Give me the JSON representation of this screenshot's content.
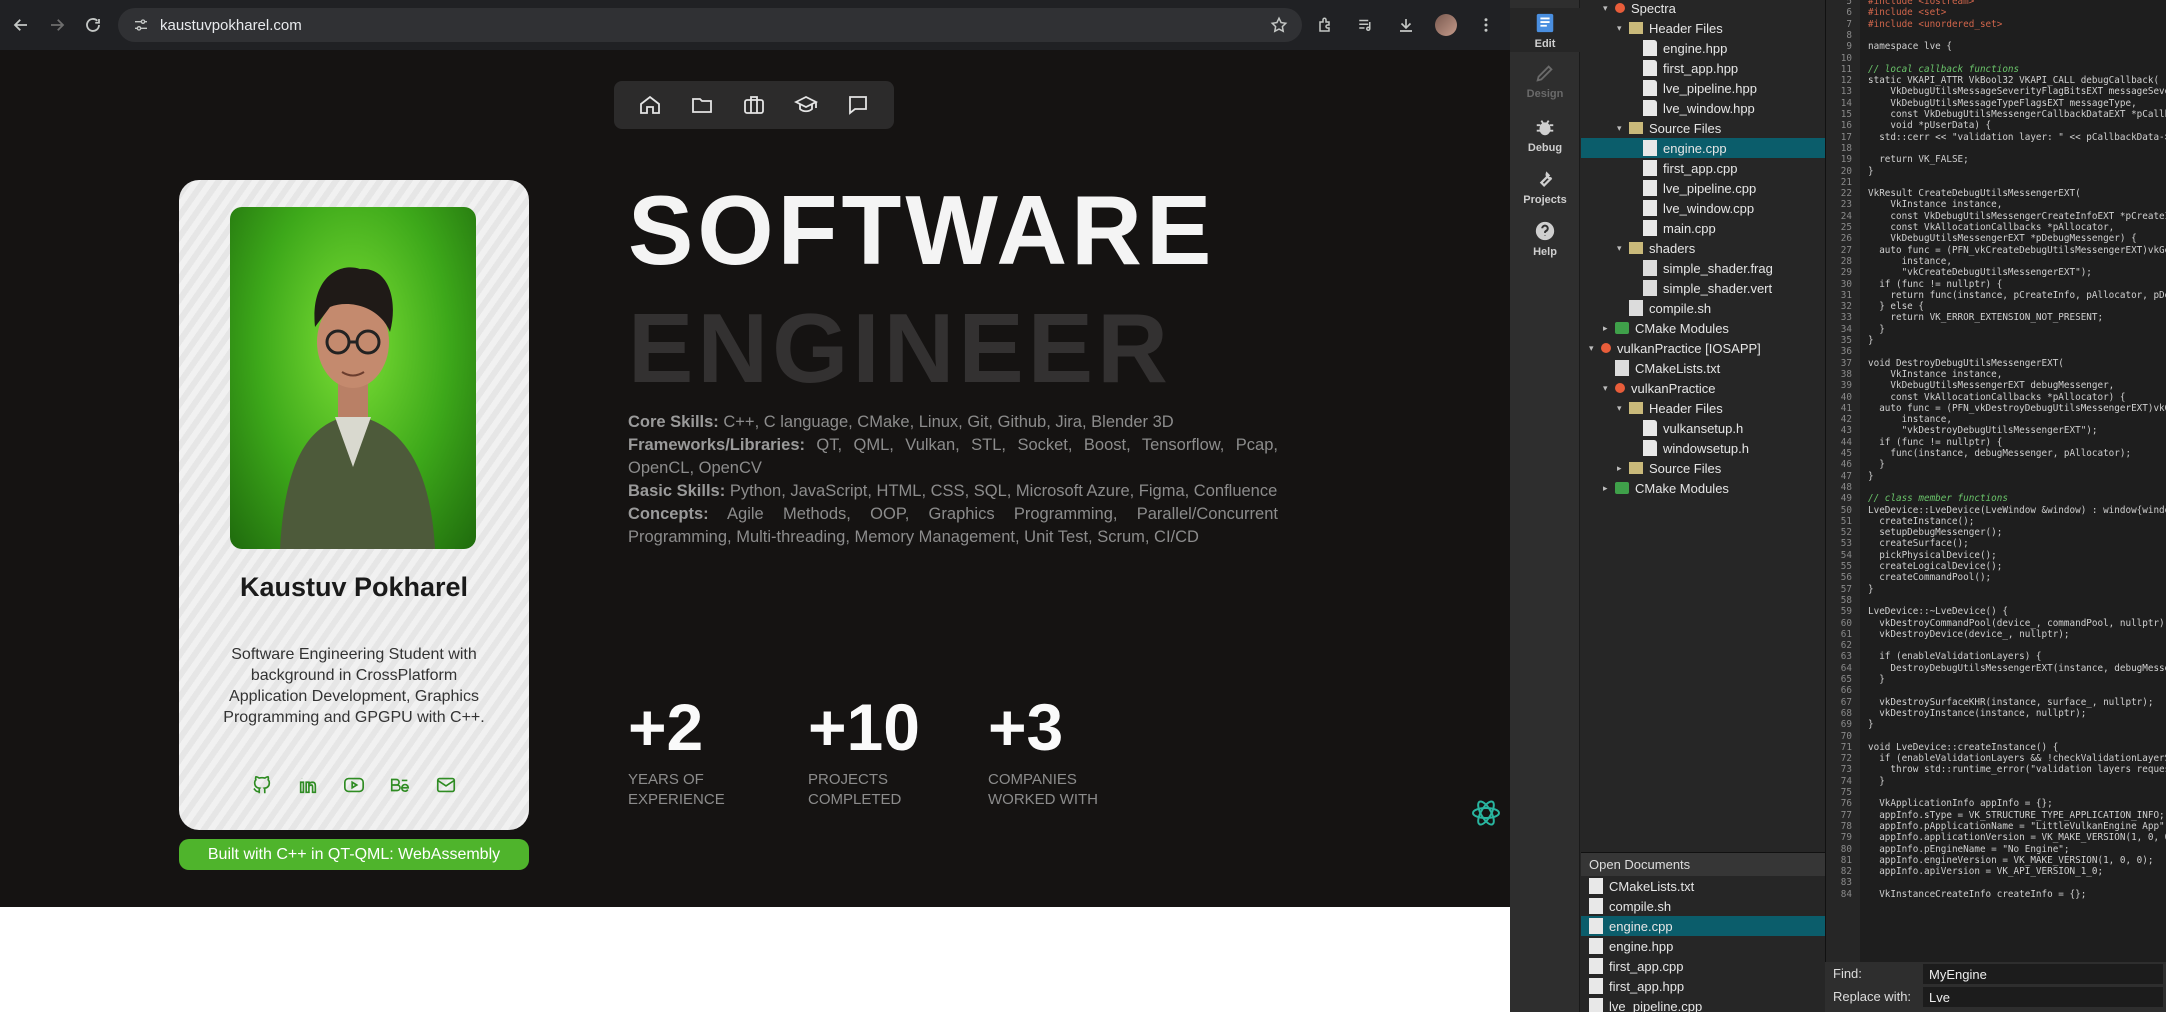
{
  "browser": {
    "url": "kaustuvpokharel.com"
  },
  "site": {
    "title_line1": "SOFTWARE",
    "title_line2": "ENGINEER",
    "profile": {
      "name": "Kaustuv Pokharel",
      "bio": "Software Engineering Student with background in CrossPlatform Application Development, Graphics Programming and GPGPU with C++.",
      "badge": "Built with C++ in QT-QML: WebAssembly"
    },
    "skills": [
      {
        "label": "Core Skills:",
        "value": " C++, C language, CMake, Linux, Git, Github, Jira, Blender 3D"
      },
      {
        "label": "Frameworks/Libraries:",
        "value": " QT, QML, Vulkan, STL, Socket, Boost, Tensorflow, Pcap, OpenCL, OpenCV"
      },
      {
        "label": "Basic Skills:",
        "value": " Python, JavaScript, HTML, CSS, SQL, Microsoft Azure, Figma, Confluence"
      },
      {
        "label": "Concepts:",
        "value": " Agile Methods, OOP, Graphics Programming, Parallel/Concurrent Programming, Multi-threading, Memory Management, Unit Test, Scrum, CI/CD"
      }
    ],
    "stats": [
      {
        "num": "+2",
        "label": "Years of Experience"
      },
      {
        "num": "+10",
        "label": "Projects Completed"
      },
      {
        "num": "+3",
        "label": "Companies Worked With"
      }
    ]
  },
  "ide": {
    "modes": [
      "Edit",
      "Design",
      "Debug",
      "Projects",
      "Help"
    ],
    "tree": [
      {
        "t": "Spectra",
        "d": 1,
        "i": "proj",
        "a": "▾"
      },
      {
        "t": "Header Files",
        "d": 2,
        "i": "dir",
        "a": "▾"
      },
      {
        "t": "engine.hpp",
        "d": 3,
        "i": "h",
        "a": ""
      },
      {
        "t": "first_app.hpp",
        "d": 3,
        "i": "h",
        "a": ""
      },
      {
        "t": "lve_pipeline.hpp",
        "d": 3,
        "i": "h",
        "a": ""
      },
      {
        "t": "lve_window.hpp",
        "d": 3,
        "i": "h",
        "a": ""
      },
      {
        "t": "Source Files",
        "d": 2,
        "i": "dir",
        "a": "▾"
      },
      {
        "t": "engine.cpp",
        "d": 3,
        "i": "cpp",
        "a": "",
        "sel": true
      },
      {
        "t": "first_app.cpp",
        "d": 3,
        "i": "cpp",
        "a": ""
      },
      {
        "t": "lve_pipeline.cpp",
        "d": 3,
        "i": "cpp",
        "a": ""
      },
      {
        "t": "lve_window.cpp",
        "d": 3,
        "i": "cpp",
        "a": ""
      },
      {
        "t": "main.cpp",
        "d": 3,
        "i": "cpp",
        "a": ""
      },
      {
        "t": "shaders",
        "d": 2,
        "i": "dir",
        "a": "▾"
      },
      {
        "t": "simple_shader.frag",
        "d": 3,
        "i": "txt",
        "a": ""
      },
      {
        "t": "simple_shader.vert",
        "d": 3,
        "i": "txt",
        "a": ""
      },
      {
        "t": "compile.sh",
        "d": 2,
        "i": "txt",
        "a": ""
      },
      {
        "t": "CMake Modules",
        "d": 1,
        "i": "cmake",
        "a": "▸"
      },
      {
        "t": "vulkanPractice [IOSAPP]",
        "d": 0,
        "i": "proj",
        "a": "▾"
      },
      {
        "t": "CMakeLists.txt",
        "d": 1,
        "i": "txt",
        "a": ""
      },
      {
        "t": "vulkanPractice",
        "d": 1,
        "i": "proj",
        "a": "▾"
      },
      {
        "t": "Header Files",
        "d": 2,
        "i": "dir",
        "a": "▾"
      },
      {
        "t": "vulkansetup.h",
        "d": 3,
        "i": "h",
        "a": ""
      },
      {
        "t": "windowsetup.h",
        "d": 3,
        "i": "h",
        "a": ""
      },
      {
        "t": "Source Files",
        "d": 2,
        "i": "dir",
        "a": "▸"
      },
      {
        "t": "CMake Modules",
        "d": 1,
        "i": "cmake",
        "a": "▸"
      }
    ],
    "open_docs_title": "Open Documents",
    "open_docs": [
      "CMakeLists.txt",
      "compile.sh",
      "engine.cpp",
      "engine.hpp",
      "first_app.cpp",
      "first_app.hpp",
      "lve_pipeline.cpp"
    ],
    "open_docs_selected": 2,
    "find_label": "Find:",
    "find_value": "MyEngine",
    "replace_label": "Replace with:",
    "replace_value": "Lve",
    "code_first_line": 5,
    "code": [
      "#include <iostream>",
      "#include <set>",
      "#include <unordered_set>",
      "",
      "namespace lve {",
      "",
      "// local callback functions",
      "static VKAPI_ATTR VkBool32 VKAPI_CALL debugCallback(",
      "    VkDebugUtilsMessageSeverityFlagBitsEXT messageSeve",
      "    VkDebugUtilsMessageTypeFlagsEXT messageType,",
      "    const VkDebugUtilsMessengerCallbackDataEXT *pCallba",
      "    void *pUserData) {",
      "  std::cerr << \"validation layer: \" << pCallbackData->",
      "",
      "  return VK_FALSE;",
      "}",
      "",
      "VkResult CreateDebugUtilsMessengerEXT(",
      "    VkInstance instance,",
      "    const VkDebugUtilsMessengerCreateInfoEXT *pCreateI",
      "    const VkAllocationCallbacks *pAllocator,",
      "    VkDebugUtilsMessengerEXT *pDebugMessenger) {",
      "  auto func = (PFN_vkCreateDebugUtilsMessengerEXT)vkGe",
      "      instance,",
      "      \"vkCreateDebugUtilsMessengerEXT\");",
      "  if (func != nullptr) {",
      "    return func(instance, pCreateInfo, pAllocator, pDe",
      "  } else {",
      "    return VK_ERROR_EXTENSION_NOT_PRESENT;",
      "  }",
      "}",
      "",
      "void DestroyDebugUtilsMessengerEXT(",
      "    VkInstance instance,",
      "    VkDebugUtilsMessengerEXT debugMessenger,",
      "    const VkAllocationCallbacks *pAllocator) {",
      "  auto func = (PFN_vkDestroyDebugUtilsMessengerEXT)vkGe",
      "      instance,",
      "      \"vkDestroyDebugUtilsMessengerEXT\");",
      "  if (func != nullptr) {",
      "    func(instance, debugMessenger, pAllocator);",
      "  }",
      "}",
      "",
      "// class member functions",
      "LveDevice::LveDevice(LveWindow &window) : window{windo",
      "  createInstance();",
      "  setupDebugMessenger();",
      "  createSurface();",
      "  pickPhysicalDevice();",
      "  createLogicalDevice();",
      "  createCommandPool();",
      "}",
      "",
      "LveDevice::~LveDevice() {",
      "  vkDestroyCommandPool(device_, commandPool, nullptr);",
      "  vkDestroyDevice(device_, nullptr);",
      "",
      "  if (enableValidationLayers) {",
      "    DestroyDebugUtilsMessengerEXT(instance, debugMesse",
      "  }",
      "",
      "  vkDestroySurfaceKHR(instance, surface_, nullptr);",
      "  vkDestroyInstance(instance, nullptr);",
      "}",
      "",
      "void LveDevice::createInstance() {",
      "  if (enableValidationLayers && !checkValidationLayerS",
      "    throw std::runtime_error(\"validation layers reques",
      "  }",
      "",
      "  VkApplicationInfo appInfo = {};",
      "  appInfo.sType = VK_STRUCTURE_TYPE_APPLICATION_INFO;",
      "  appInfo.pApplicationName = \"LittleVulkanEngine App\";",
      "  appInfo.applicationVersion = VK_MAKE_VERSION(1, 0, 0",
      "  appInfo.pEngineName = \"No Engine\";",
      "  appInfo.engineVersion = VK_MAKE_VERSION(1, 0, 0);",
      "  appInfo.apiVersion = VK_API_VERSION_1_0;",
      "",
      "  VkInstanceCreateInfo createInfo = {};"
    ]
  }
}
